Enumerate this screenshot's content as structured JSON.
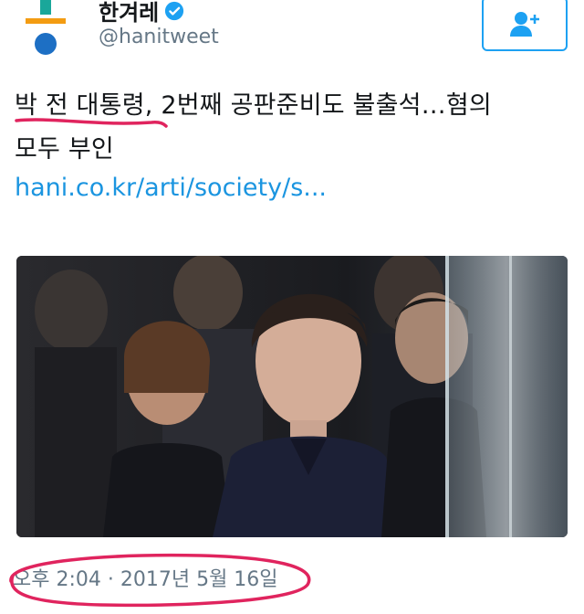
{
  "account": {
    "display_name": "한겨레",
    "handle": "@hanitweet",
    "verified": true,
    "logo_icon": "hankyoreh-logo",
    "colors": {
      "logo_teal": "#1aa79a",
      "logo_orange": "#f39c12",
      "logo_blue": "#1d6fc4",
      "accent": "#1da1f2"
    }
  },
  "follow_button": {
    "icon": "add-user-icon"
  },
  "tweet": {
    "text_line1": "박 전 대통령, 2번째 공판준비도 불출석…혐의",
    "text_line2": "모두 부인",
    "link": "hani.co.kr/arti/society/s..."
  },
  "media": {
    "description_icon": "news-photo"
  },
  "timestamp": "오후 2:04 · 2017년 5월 16일",
  "annotation": {
    "color": "#e0245e"
  }
}
